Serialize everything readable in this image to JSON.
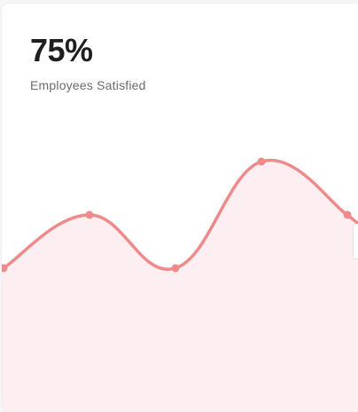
{
  "card": {
    "value": "75%",
    "label": "Employees Satisfied"
  },
  "sparkline": {
    "values": [
      3,
      5,
      3,
      7,
      5
    ],
    "min": 0,
    "max": 10,
    "line_color": "#f08a8a",
    "fill_color": "#fdeff1"
  }
}
